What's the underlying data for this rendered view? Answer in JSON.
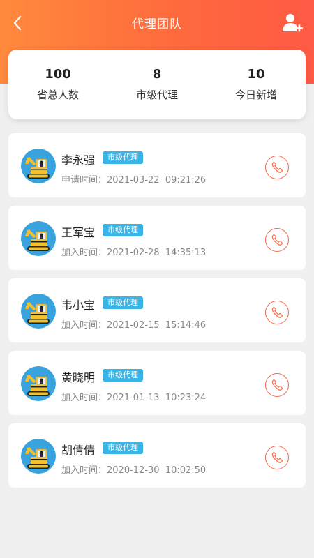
{
  "nav": {
    "title": "代理团队",
    "back_icon": "chevron-left-icon",
    "add_icon": "add-user-icon"
  },
  "stats": [
    {
      "value": "100",
      "label": "省总人数"
    },
    {
      "value": "8",
      "label": "市级代理"
    },
    {
      "value": "10",
      "label": "今日新增"
    }
  ],
  "agents": [
    {
      "name": "李永强",
      "tag": "市级代理",
      "time": "申请时间：2021-03-22  09:21:26"
    },
    {
      "name": "王军宝",
      "tag": "市级代理",
      "time": "加入时间：2021-02-28  14:35:13"
    },
    {
      "name": "韦小宝",
      "tag": "市级代理",
      "time": "加入时间：2021-02-15  15:14:46"
    },
    {
      "name": "黄晓明",
      "tag": "市级代理",
      "time": "加入时间：2021-01-13  10:23:24"
    },
    {
      "name": "胡倩倩",
      "tag": "市级代理",
      "time": "加入时间：2020-12-30  10:02:50"
    }
  ],
  "colors": {
    "header_start": "#ff8a3d",
    "header_end": "#ff5a45",
    "tag_bg": "#39b4e6",
    "phone_accent": "#f06a48",
    "avatar_bg": "#3aa3dd"
  }
}
